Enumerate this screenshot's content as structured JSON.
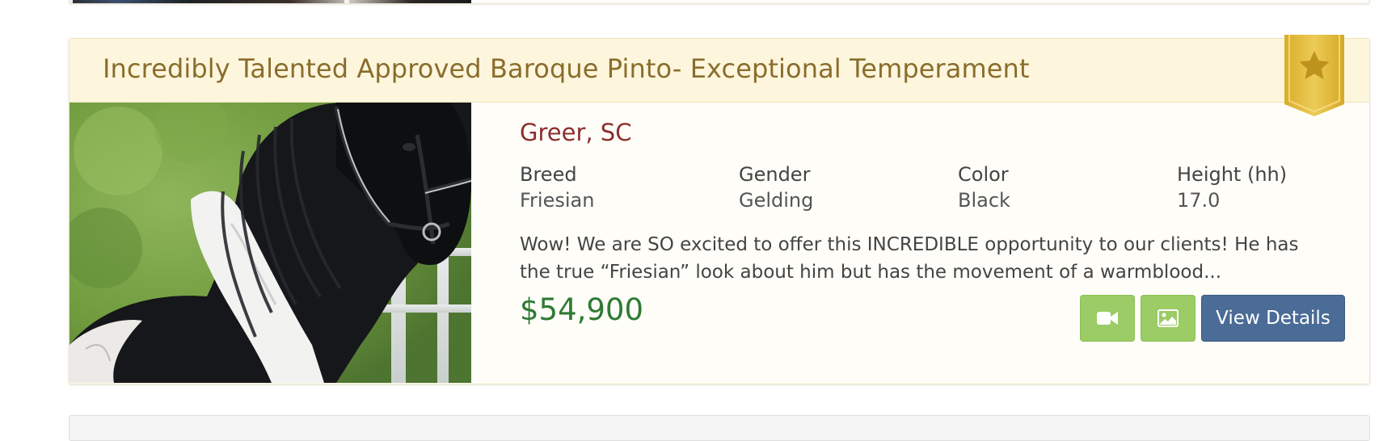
{
  "listing": {
    "title": "Incredibly Talented Approved Baroque Pinto- Exceptional Temperament",
    "featured_badge_icon": "star-icon",
    "location": "Greer, SC",
    "attributes": [
      {
        "label": "Breed",
        "value": "Friesian"
      },
      {
        "label": "Gender",
        "value": "Gelding"
      },
      {
        "label": "Color",
        "value": "Black"
      },
      {
        "label": "Height (hh)",
        "value": "17.0"
      }
    ],
    "description": "Wow! We are SO excited to offer this INCREDIBLE opportunity to our clients! He has the true “Friesian” look about him but has the movement of a warmblood...",
    "price": "$54,900",
    "actions": {
      "video_icon": "video-camera-icon",
      "photos_icon": "image-icon",
      "details_label": "View Details"
    }
  },
  "colors": {
    "title": "#8a6d2c",
    "header_bg": "#fdf6dd",
    "location": "#8b2e2e",
    "price": "#2f7a33",
    "icon_button": "#9ccc65",
    "details_button": "#4a6c96",
    "ribbon": "#e3bd3c"
  }
}
